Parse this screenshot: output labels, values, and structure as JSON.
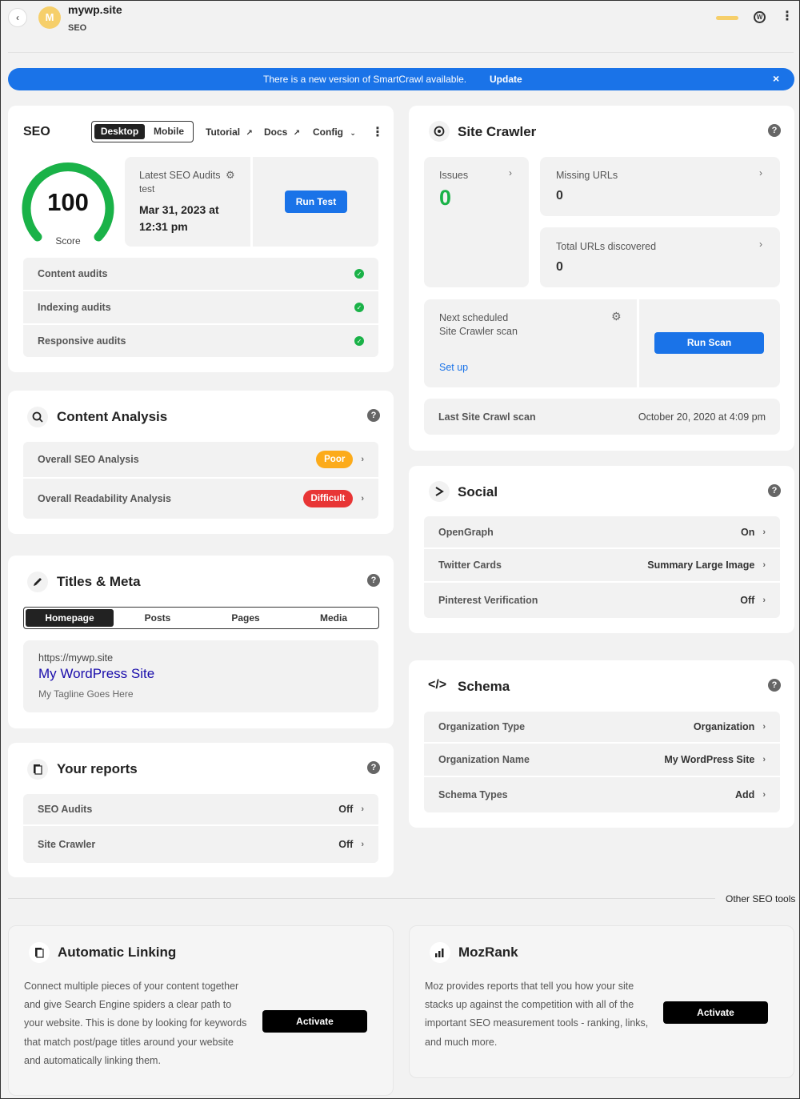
{
  "header": {
    "avatar_letter": "M",
    "site_name": "mywp.site",
    "section": "SEO"
  },
  "notice": {
    "text": "There is a new version of SmartCrawl available.",
    "link": "Update"
  },
  "seo": {
    "title": "SEO",
    "tabs": [
      "Desktop",
      "Mobile"
    ],
    "links": {
      "tutorial": "Tutorial",
      "docs": "Docs",
      "config": "Config"
    },
    "score": "100",
    "score_label": "Score",
    "score_fraction": 1.0,
    "latest_label": "Latest SEO Audits",
    "latest_sub": "test",
    "date_line1": "Mar 31, 2023 at",
    "date_line2": "12:31 pm",
    "run_test": "Run Test",
    "audits": [
      "Content audits",
      "Indexing audits",
      "Responsive audits"
    ]
  },
  "content_analysis": {
    "title": "Content Analysis",
    "rows": [
      {
        "label": "Overall SEO Analysis",
        "badge": "Poor",
        "color": "#fcab1a"
      },
      {
        "label": "Overall Readability Analysis",
        "badge": "Difficult",
        "color": "#e83535"
      }
    ]
  },
  "titles_meta": {
    "title": "Titles & Meta",
    "tabs": [
      "Homepage",
      "Posts",
      "Pages",
      "Media"
    ],
    "preview_url": "https://mywp.site",
    "preview_title": "My WordPress Site",
    "preview_tagline": "My Tagline Goes Here"
  },
  "reports": {
    "title": "Your reports",
    "rows": [
      {
        "label": "SEO Audits",
        "value": "Off"
      },
      {
        "label": "Site Crawler",
        "value": "Off"
      }
    ]
  },
  "crawler": {
    "title": "Site Crawler",
    "issues_label": "Issues",
    "issues_value": "0",
    "missing_label": "Missing URLs",
    "missing_value": "0",
    "total_label": "Total URLs discovered",
    "total_value": "0",
    "next_line1": "Next scheduled",
    "next_line2": "Site Crawler scan",
    "setup": "Set up",
    "run_scan": "Run Scan",
    "last_label": "Last Site Crawl scan",
    "last_value": "October 20, 2020 at 4:09 pm"
  },
  "social": {
    "title": "Social",
    "rows": [
      {
        "label": "OpenGraph",
        "value": "On"
      },
      {
        "label": "Twitter Cards",
        "value": "Summary Large Image"
      },
      {
        "label": "Pinterest Verification",
        "value": "Off"
      }
    ]
  },
  "schema": {
    "title": "Schema",
    "rows": [
      {
        "label": "Organization Type",
        "value": "Organization"
      },
      {
        "label": "Organization Name",
        "value": "My WordPress Site"
      },
      {
        "label": "Schema Types",
        "value": "Add"
      }
    ]
  },
  "other_tools": {
    "label": "Other SEO tools",
    "linking": {
      "title": "Automatic Linking",
      "lines": [
        "Connect multiple pieces of your content together",
        "and give Search Engine spiders a clear path to",
        "your website. This is done by looking for keywords",
        "that match post/page titles around your website",
        "and automatically linking them."
      ],
      "button": "Activate"
    },
    "mozrank": {
      "title": "MozRank",
      "lines": [
        "Moz provides reports that tell you how your site",
        "stacks up against the competition with all of the",
        "important SEO measurement tools - ranking, links,",
        "and much more."
      ],
      "button": "Activate"
    }
  }
}
